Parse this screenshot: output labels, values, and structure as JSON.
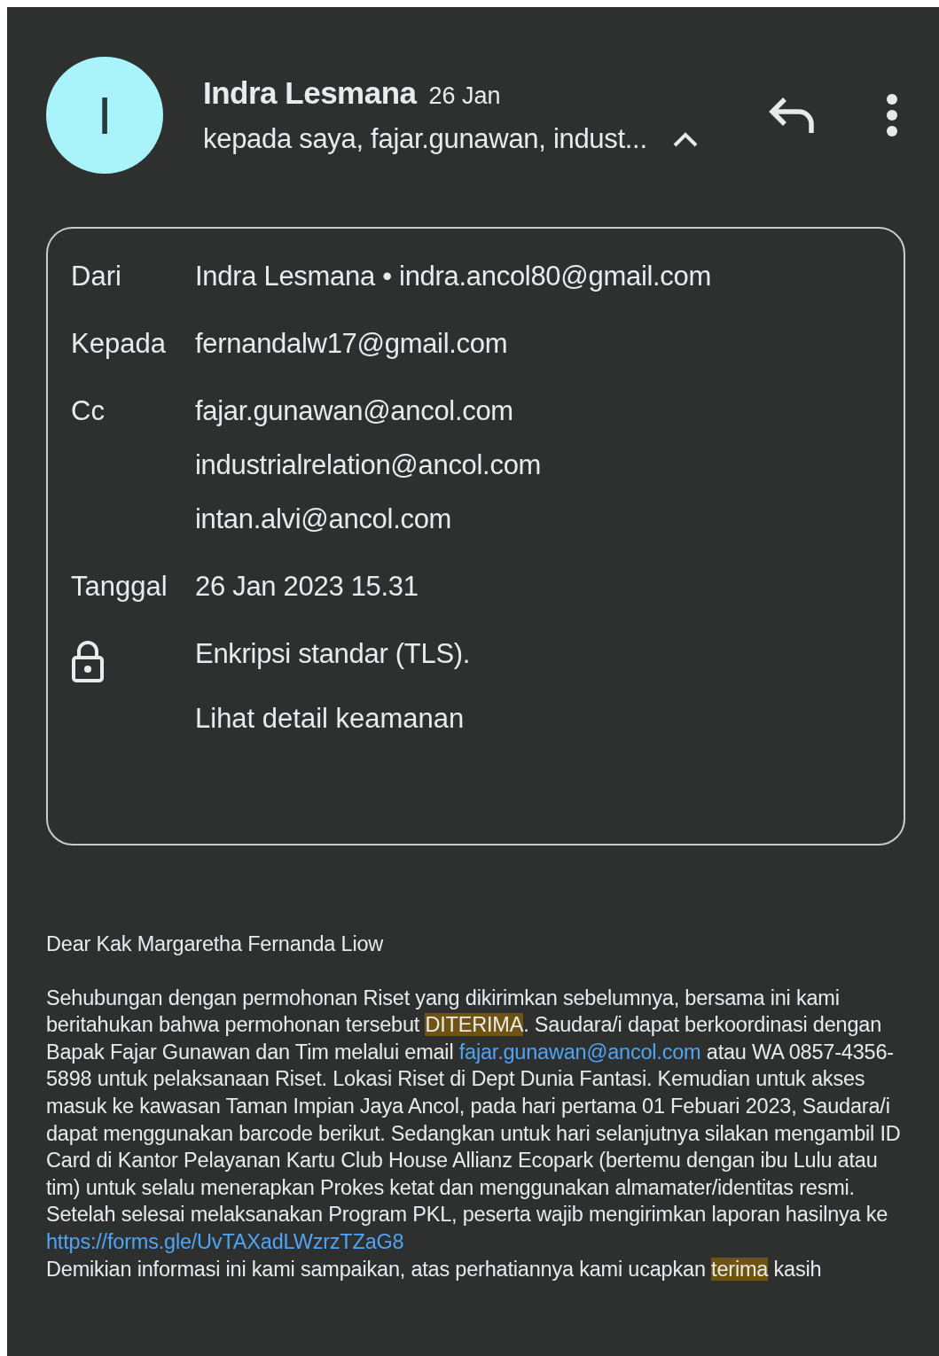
{
  "header": {
    "avatar_letter": "I",
    "sender": "Indra Lesmana",
    "date": "26 Jan",
    "recipients": "kepada saya, fajar.gunawan, indust...",
    "expanded": true
  },
  "details": [
    {
      "kind": "field",
      "label": "Dari",
      "values": [
        "Indra Lesmana • indra.ancol80@gmail.com"
      ]
    },
    {
      "kind": "field",
      "label": "Kepada",
      "values": [
        "fernandalw17@gmail.com"
      ]
    },
    {
      "kind": "field",
      "label": "Cc",
      "values": [
        "fajar.gunawan@ancol.com",
        "industrialrelation@ancol.com",
        "intan.alvi@ancol.com"
      ]
    },
    {
      "kind": "field",
      "label": "Tanggal",
      "values": [
        "26 Jan 2023 15.31"
      ]
    },
    {
      "kind": "security",
      "label": "Enkripsi standar (TLS).",
      "link": "Lihat detail keamanan"
    }
  ],
  "body": {
    "greeting": "Dear Kak Margaretha Fernanda Liow",
    "paragraphs": [
      [
        {
          "kind": "plain",
          "text": "Sehubungan dengan permohonan Riset yang dikirimkan sebelumnya, bersama ini kami beritahukan bahwa permohonan tersebut "
        },
        {
          "kind": "highlight",
          "text": "DITERIMA"
        },
        {
          "kind": "plain",
          "text": ". Saudara/i dapat berkoordinasi dengan Bapak Fajar Gunawan dan Tim melalui email "
        },
        {
          "kind": "link",
          "text": "fajar.gunawan@ancol.com"
        },
        {
          "kind": "plain",
          "text": " atau WA 0857-4356-5898  untuk pelaksanaan Riset. Lokasi Riset di Dept Dunia Fantasi. Kemudian untuk akses masuk ke kawasan Taman Impian Jaya Ancol, pada hari pertama 01 Febuari 2023, Saudara/i dapat menggunakan barcode berikut. Sedangkan untuk hari selanjutnya silakan mengambil ID Card di Kantor Pelayanan Kartu Club House Allianz Ecopark (bertemu dengan ibu Lulu atau tim) untuk selalu menerapkan Prokes ketat dan menggunakan almamater/identitas resmi. Setelah selesai melaksanakan Program PKL, peserta wajib mengirimkan laporan hasilnya ke "
        },
        {
          "kind": "link",
          "text": "https://forms.gle/UvTAXadLWzrzTZaG8"
        }
      ],
      [
        {
          "kind": "plain",
          "text": "Demikian informasi ini kami sampaikan, atas perhatiannya kami ucapkan "
        },
        {
          "kind": "highlight",
          "text": "terima"
        },
        {
          "kind": "plain",
          "text": " kasih"
        }
      ]
    ]
  }
}
